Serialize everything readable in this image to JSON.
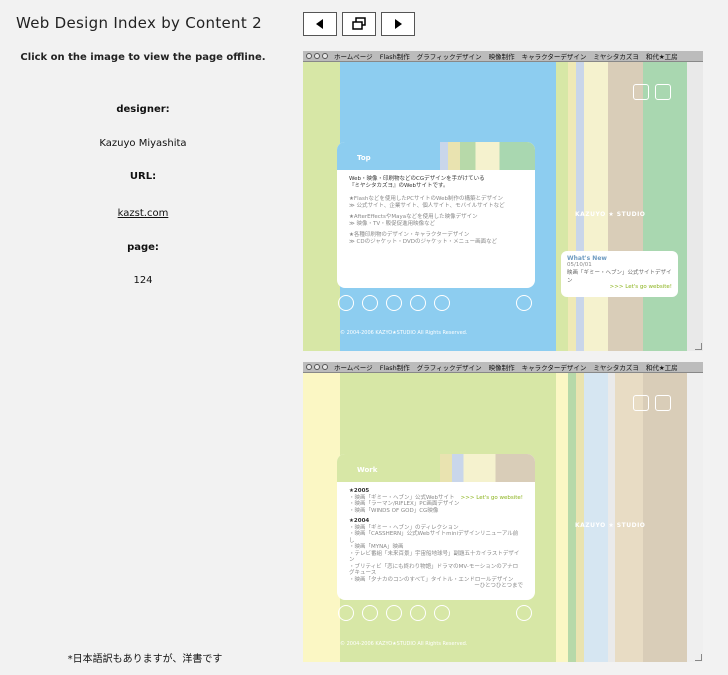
{
  "header": {
    "title": "Web Design Index by Content 2"
  },
  "nav": {
    "prev_label": "◀",
    "overview_label": "",
    "next_label": "▶"
  },
  "info": {
    "hint": "Click on the image to view the page offline.",
    "designer_label": "designer:",
    "designer": "Kazuyo Miyashita",
    "url_label": "URL:",
    "url": "kazst.com",
    "page_label": "page:",
    "page": "124"
  },
  "footnote": "*日本語訳もありますが、洋書です",
  "screenshots": {
    "menu": [
      "ホームページ",
      "Flash制作",
      "グラフィックデザイン",
      "映像制作",
      "キャラクターデザイン",
      "ミヤシタカズヨ",
      "和代★工房"
    ],
    "top_panel_title": "Top",
    "top_panel_lines": [
      "Web・映像・印刷物などのCGデザインを手がけている",
      "『ミヤシタカズヨ』のWebサイトです。",
      "★Flashなどを使用したPCサイトのWeb制作の構築とデザイン",
      "≫ 公式サイト、企業サイト、個人サイト、モバイルサイトなど",
      "★AfterEffectsやMayaなどを使用した映像デザイン",
      "≫ 映像・TV・販促促進用映像など",
      "★各種印刷物のデザイン・キャラクターデザイン",
      "≫ CDのジャケット・DVDのジャケット・メニュー画面など"
    ],
    "whats_new_title": "What's New",
    "whats_new_date": "05/10/01",
    "whats_new_text": "映画「ギミー・ヘブン」公式サイトデザイン",
    "whats_new_link": ">>> Let's go website!",
    "kazyo": "KAZUYO ★ STUDIO",
    "copyright": "© 2004-2006 KAZYO★STUDIO All Rights Reserved.",
    "work_panel_title": "Work",
    "work_lines": [
      "★2005",
      "・映画「ギミー・ヘブン」公式Webサイト",
      "・映画「ラーマン/RIFLEX」PC画面デザイン",
      "・映画「WINDS OF GOD」CG映像",
      "★2004",
      "・映画「ギミー・ヘブン」のディレクション",
      "・映画「CASSHERN」公式Webサイトminiデザインリニューアル前し",
      "・映画「MYNA」映画",
      "・テレビ番組「未来百景」宇宙船地球号」副題五十カイラストデザイン",
      "・ブリティビ「恋にも終わり物語」ドラマのMV-モーションのアナログキュース",
      "・映画「夕ナカのコンのすべて」タイトル・エンドロールデザイン"
    ],
    "work_sign": "ーひとつひとつまで",
    "work_link": ">>> Let's go website!"
  },
  "colors": {
    "bg": "#f2f2f2",
    "blue": "#8dcdf0",
    "green": "#d7e7a6",
    "yellow": "#fbf7c4",
    "lavender": "#c9d6ea",
    "tan": "#d9cdb8",
    "mint": "#a9d7b0"
  }
}
